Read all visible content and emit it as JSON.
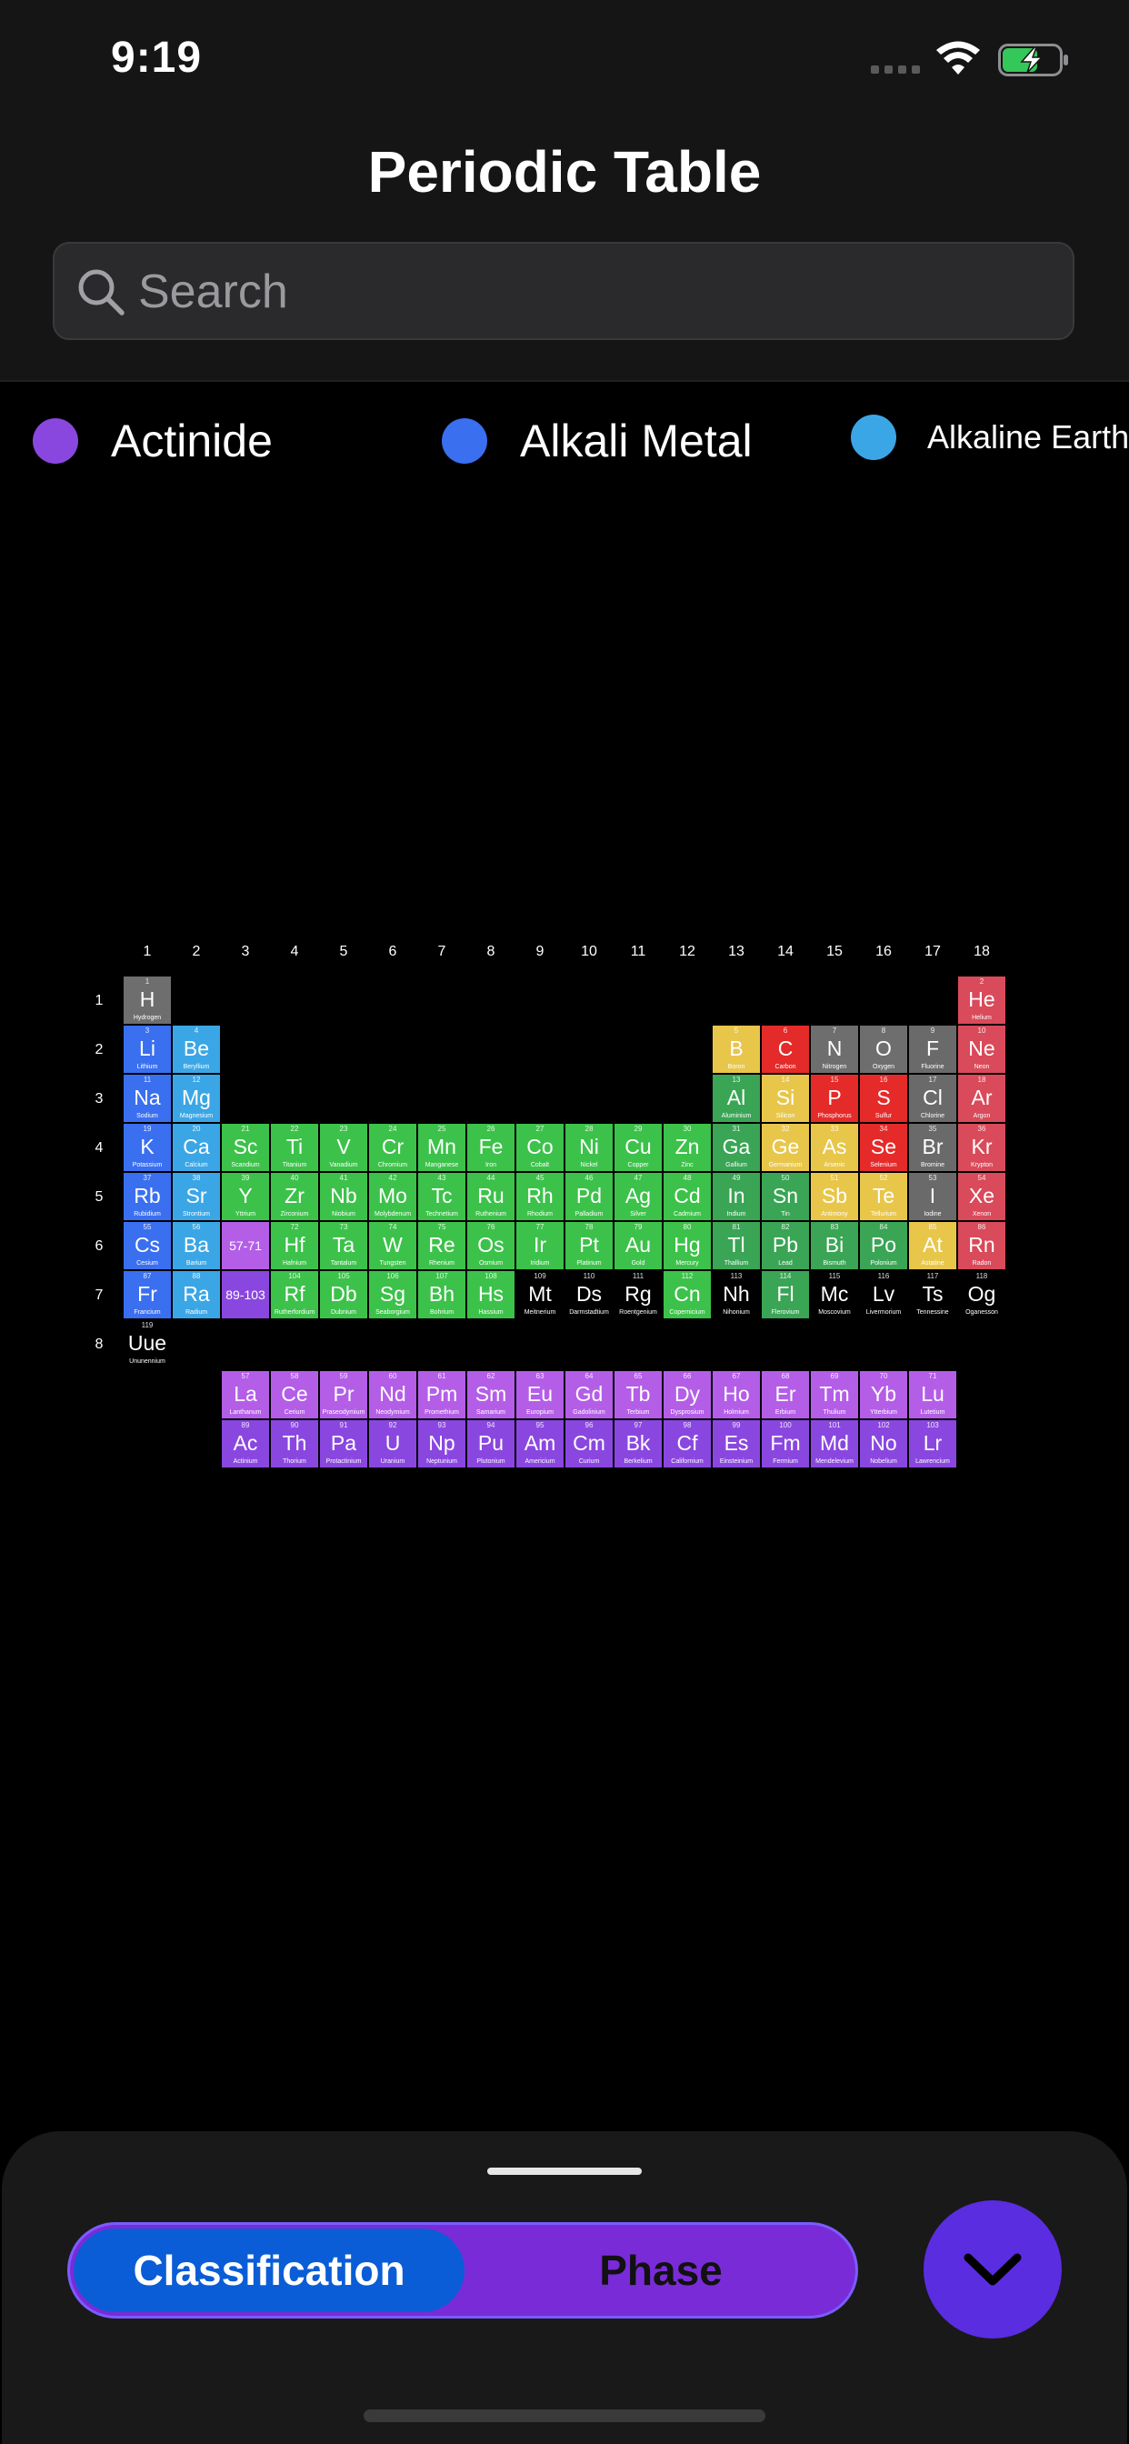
{
  "status": {
    "time": "9:19"
  },
  "header": {
    "title": "Periodic Table"
  },
  "search": {
    "placeholder": "Search"
  },
  "legend": [
    {
      "label": "Actinide",
      "color": "#8a47e0"
    },
    {
      "label": "Alkali Metal",
      "color": "#3a6ff0"
    },
    {
      "label": "Alkaline Earth",
      "color": "#3ba6e6"
    }
  ],
  "colors": {
    "H": "#6e6e6e",
    "noble": "#d94a5a",
    "alkali": "#3a6ff0",
    "alkaline": "#3ba6e6",
    "transition": "#3cc24a",
    "post": "#3aa555",
    "metalloid": "#e8c64a",
    "nonmetal": "#6e6e6e",
    "reactive": "#e52a2a",
    "halogen": "#6a6a6a",
    "lanth": "#b45ee8",
    "actin": "#8a47e0",
    "unknown": "#000000",
    "fab": "#5a2de0",
    "segActive": "#0a5dd6",
    "segBg": "#7a2bd8"
  },
  "groups": [
    "1",
    "2",
    "3",
    "4",
    "5",
    "6",
    "7",
    "8",
    "9",
    "10",
    "11",
    "12",
    "13",
    "14",
    "15",
    "16",
    "17",
    "18"
  ],
  "periods": [
    "1",
    "2",
    "3",
    "4",
    "5",
    "6",
    "7",
    "8"
  ],
  "placeholders": {
    "lanth": "57-71",
    "actin": "89-103"
  },
  "elements": [
    {
      "n": "1",
      "s": "H",
      "name": "Hydrogen",
      "g": 1,
      "p": 1,
      "c": "H"
    },
    {
      "n": "2",
      "s": "He",
      "name": "Helium",
      "g": 18,
      "p": 1,
      "c": "noble"
    },
    {
      "n": "3",
      "s": "Li",
      "name": "Lithium",
      "g": 1,
      "p": 2,
      "c": "alkali"
    },
    {
      "n": "4",
      "s": "Be",
      "name": "Beryllium",
      "g": 2,
      "p": 2,
      "c": "alkaline"
    },
    {
      "n": "5",
      "s": "B",
      "name": "Boron",
      "g": 13,
      "p": 2,
      "c": "metalloid"
    },
    {
      "n": "6",
      "s": "C",
      "name": "Carbon",
      "g": 14,
      "p": 2,
      "c": "reactive"
    },
    {
      "n": "7",
      "s": "N",
      "name": "Nitrogen",
      "g": 15,
      "p": 2,
      "c": "nonmetal"
    },
    {
      "n": "8",
      "s": "O",
      "name": "Oxygen",
      "g": 16,
      "p": 2,
      "c": "nonmetal"
    },
    {
      "n": "9",
      "s": "F",
      "name": "Fluorine",
      "g": 17,
      "p": 2,
      "c": "halogen"
    },
    {
      "n": "10",
      "s": "Ne",
      "name": "Neon",
      "g": 18,
      "p": 2,
      "c": "noble"
    },
    {
      "n": "11",
      "s": "Na",
      "name": "Sodium",
      "g": 1,
      "p": 3,
      "c": "alkali"
    },
    {
      "n": "12",
      "s": "Mg",
      "name": "Magnesium",
      "g": 2,
      "p": 3,
      "c": "alkaline"
    },
    {
      "n": "13",
      "s": "Al",
      "name": "Aluminium",
      "g": 13,
      "p": 3,
      "c": "post"
    },
    {
      "n": "14",
      "s": "Si",
      "name": "Silicon",
      "g": 14,
      "p": 3,
      "c": "metalloid"
    },
    {
      "n": "15",
      "s": "P",
      "name": "Phosphorus",
      "g": 15,
      "p": 3,
      "c": "reactive"
    },
    {
      "n": "16",
      "s": "S",
      "name": "Sulfur",
      "g": 16,
      "p": 3,
      "c": "reactive"
    },
    {
      "n": "17",
      "s": "Cl",
      "name": "Chlorine",
      "g": 17,
      "p": 3,
      "c": "halogen"
    },
    {
      "n": "18",
      "s": "Ar",
      "name": "Argon",
      "g": 18,
      "p": 3,
      "c": "noble"
    },
    {
      "n": "19",
      "s": "K",
      "name": "Potassium",
      "g": 1,
      "p": 4,
      "c": "alkali"
    },
    {
      "n": "20",
      "s": "Ca",
      "name": "Calcium",
      "g": 2,
      "p": 4,
      "c": "alkaline"
    },
    {
      "n": "21",
      "s": "Sc",
      "name": "Scandium",
      "g": 3,
      "p": 4,
      "c": "transition"
    },
    {
      "n": "22",
      "s": "Ti",
      "name": "Titanium",
      "g": 4,
      "p": 4,
      "c": "transition"
    },
    {
      "n": "23",
      "s": "V",
      "name": "Vanadium",
      "g": 5,
      "p": 4,
      "c": "transition"
    },
    {
      "n": "24",
      "s": "Cr",
      "name": "Chromium",
      "g": 6,
      "p": 4,
      "c": "transition"
    },
    {
      "n": "25",
      "s": "Mn",
      "name": "Manganese",
      "g": 7,
      "p": 4,
      "c": "transition"
    },
    {
      "n": "26",
      "s": "Fe",
      "name": "Iron",
      "g": 8,
      "p": 4,
      "c": "transition"
    },
    {
      "n": "27",
      "s": "Co",
      "name": "Cobalt",
      "g": 9,
      "p": 4,
      "c": "transition"
    },
    {
      "n": "28",
      "s": "Ni",
      "name": "Nickel",
      "g": 10,
      "p": 4,
      "c": "transition"
    },
    {
      "n": "29",
      "s": "Cu",
      "name": "Copper",
      "g": 11,
      "p": 4,
      "c": "transition"
    },
    {
      "n": "30",
      "s": "Zn",
      "name": "Zinc",
      "g": 12,
      "p": 4,
      "c": "transition"
    },
    {
      "n": "31",
      "s": "Ga",
      "name": "Gallium",
      "g": 13,
      "p": 4,
      "c": "post"
    },
    {
      "n": "32",
      "s": "Ge",
      "name": "Germanium",
      "g": 14,
      "p": 4,
      "c": "metalloid"
    },
    {
      "n": "33",
      "s": "As",
      "name": "Arsenic",
      "g": 15,
      "p": 4,
      "c": "metalloid"
    },
    {
      "n": "34",
      "s": "Se",
      "name": "Selenium",
      "g": 16,
      "p": 4,
      "c": "reactive"
    },
    {
      "n": "35",
      "s": "Br",
      "name": "Bromine",
      "g": 17,
      "p": 4,
      "c": "halogen"
    },
    {
      "n": "36",
      "s": "Kr",
      "name": "Krypton",
      "g": 18,
      "p": 4,
      "c": "noble"
    },
    {
      "n": "37",
      "s": "Rb",
      "name": "Rubidium",
      "g": 1,
      "p": 5,
      "c": "alkali"
    },
    {
      "n": "38",
      "s": "Sr",
      "name": "Strontium",
      "g": 2,
      "p": 5,
      "c": "alkaline"
    },
    {
      "n": "39",
      "s": "Y",
      "name": "Yttrium",
      "g": 3,
      "p": 5,
      "c": "transition"
    },
    {
      "n": "40",
      "s": "Zr",
      "name": "Zirconium",
      "g": 4,
      "p": 5,
      "c": "transition"
    },
    {
      "n": "41",
      "s": "Nb",
      "name": "Niobium",
      "g": 5,
      "p": 5,
      "c": "transition"
    },
    {
      "n": "42",
      "s": "Mo",
      "name": "Molybdenum",
      "g": 6,
      "p": 5,
      "c": "transition"
    },
    {
      "n": "43",
      "s": "Tc",
      "name": "Technetium",
      "g": 7,
      "p": 5,
      "c": "transition"
    },
    {
      "n": "44",
      "s": "Ru",
      "name": "Ruthenium",
      "g": 8,
      "p": 5,
      "c": "transition"
    },
    {
      "n": "45",
      "s": "Rh",
      "name": "Rhodium",
      "g": 9,
      "p": 5,
      "c": "transition"
    },
    {
      "n": "46",
      "s": "Pd",
      "name": "Palladium",
      "g": 10,
      "p": 5,
      "c": "transition"
    },
    {
      "n": "47",
      "s": "Ag",
      "name": "Silver",
      "g": 11,
      "p": 5,
      "c": "transition"
    },
    {
      "n": "48",
      "s": "Cd",
      "name": "Cadmium",
      "g": 12,
      "p": 5,
      "c": "transition"
    },
    {
      "n": "49",
      "s": "In",
      "name": "Indium",
      "g": 13,
      "p": 5,
      "c": "post"
    },
    {
      "n": "50",
      "s": "Sn",
      "name": "Tin",
      "g": 14,
      "p": 5,
      "c": "post"
    },
    {
      "n": "51",
      "s": "Sb",
      "name": "Antimony",
      "g": 15,
      "p": 5,
      "c": "metalloid"
    },
    {
      "n": "52",
      "s": "Te",
      "name": "Tellurium",
      "g": 16,
      "p": 5,
      "c": "metalloid"
    },
    {
      "n": "53",
      "s": "I",
      "name": "Iodine",
      "g": 17,
      "p": 5,
      "c": "halogen"
    },
    {
      "n": "54",
      "s": "Xe",
      "name": "Xenon",
      "g": 18,
      "p": 5,
      "c": "noble"
    },
    {
      "n": "55",
      "s": "Cs",
      "name": "Cesium",
      "g": 1,
      "p": 6,
      "c": "alkali"
    },
    {
      "n": "56",
      "s": "Ba",
      "name": "Barium",
      "g": 2,
      "p": 6,
      "c": "alkaline"
    },
    {
      "n": "72",
      "s": "Hf",
      "name": "Hafnium",
      "g": 4,
      "p": 6,
      "c": "transition"
    },
    {
      "n": "73",
      "s": "Ta",
      "name": "Tantalum",
      "g": 5,
      "p": 6,
      "c": "transition"
    },
    {
      "n": "74",
      "s": "W",
      "name": "Tungsten",
      "g": 6,
      "p": 6,
      "c": "transition"
    },
    {
      "n": "75",
      "s": "Re",
      "name": "Rhenium",
      "g": 7,
      "p": 6,
      "c": "transition"
    },
    {
      "n": "76",
      "s": "Os",
      "name": "Osmium",
      "g": 8,
      "p": 6,
      "c": "transition"
    },
    {
      "n": "77",
      "s": "Ir",
      "name": "Iridium",
      "g": 9,
      "p": 6,
      "c": "transition"
    },
    {
      "n": "78",
      "s": "Pt",
      "name": "Platinum",
      "g": 10,
      "p": 6,
      "c": "transition"
    },
    {
      "n": "79",
      "s": "Au",
      "name": "Gold",
      "g": 11,
      "p": 6,
      "c": "transition"
    },
    {
      "n": "80",
      "s": "Hg",
      "name": "Mercury",
      "g": 12,
      "p": 6,
      "c": "transition"
    },
    {
      "n": "81",
      "s": "Tl",
      "name": "Thallium",
      "g": 13,
      "p": 6,
      "c": "post"
    },
    {
      "n": "82",
      "s": "Pb",
      "name": "Lead",
      "g": 14,
      "p": 6,
      "c": "post"
    },
    {
      "n": "83",
      "s": "Bi",
      "name": "Bismuth",
      "g": 15,
      "p": 6,
      "c": "post"
    },
    {
      "n": "84",
      "s": "Po",
      "name": "Polonium",
      "g": 16,
      "p": 6,
      "c": "post"
    },
    {
      "n": "85",
      "s": "At",
      "name": "Astatine",
      "g": 17,
      "p": 6,
      "c": "metalloid"
    },
    {
      "n": "86",
      "s": "Rn",
      "name": "Radon",
      "g": 18,
      "p": 6,
      "c": "noble"
    },
    {
      "n": "87",
      "s": "Fr",
      "name": "Francium",
      "g": 1,
      "p": 7,
      "c": "alkali"
    },
    {
      "n": "88",
      "s": "Ra",
      "name": "Radium",
      "g": 2,
      "p": 7,
      "c": "alkaline"
    },
    {
      "n": "104",
      "s": "Rf",
      "name": "Rutherfordium",
      "g": 4,
      "p": 7,
      "c": "transition"
    },
    {
      "n": "105",
      "s": "Db",
      "name": "Dubnium",
      "g": 5,
      "p": 7,
      "c": "transition"
    },
    {
      "n": "106",
      "s": "Sg",
      "name": "Seaborgium",
      "g": 6,
      "p": 7,
      "c": "transition"
    },
    {
      "n": "107",
      "s": "Bh",
      "name": "Bohrium",
      "g": 7,
      "p": 7,
      "c": "transition"
    },
    {
      "n": "108",
      "s": "Hs",
      "name": "Hassium",
      "g": 8,
      "p": 7,
      "c": "transition"
    },
    {
      "n": "109",
      "s": "Mt",
      "name": "Meitnerium",
      "g": 9,
      "p": 7,
      "c": "unknown"
    },
    {
      "n": "110",
      "s": "Ds",
      "name": "Darmstadtium",
      "g": 10,
      "p": 7,
      "c": "unknown"
    },
    {
      "n": "111",
      "s": "Rg",
      "name": "Roentgenium",
      "g": 11,
      "p": 7,
      "c": "unknown"
    },
    {
      "n": "112",
      "s": "Cn",
      "name": "Copernicium",
      "g": 12,
      "p": 7,
      "c": "transition"
    },
    {
      "n": "113",
      "s": "Nh",
      "name": "Nihonium",
      "g": 13,
      "p": 7,
      "c": "unknown"
    },
    {
      "n": "114",
      "s": "Fl",
      "name": "Flerovium",
      "g": 14,
      "p": 7,
      "c": "post"
    },
    {
      "n": "115",
      "s": "Mc",
      "name": "Moscovium",
      "g": 15,
      "p": 7,
      "c": "unknown"
    },
    {
      "n": "116",
      "s": "Lv",
      "name": "Livermorium",
      "g": 16,
      "p": 7,
      "c": "unknown"
    },
    {
      "n": "117",
      "s": "Ts",
      "name": "Tennessine",
      "g": 17,
      "p": 7,
      "c": "unknown"
    },
    {
      "n": "118",
      "s": "Og",
      "name": "Oganesson",
      "g": 18,
      "p": 7,
      "c": "unknown"
    },
    {
      "n": "119",
      "s": "Uue",
      "name": "Ununennium",
      "g": 1,
      "p": 8,
      "c": "unknown"
    },
    {
      "n": "57",
      "s": "La",
      "name": "Lanthanum",
      "g": 3,
      "p": 9,
      "c": "lanth"
    },
    {
      "n": "58",
      "s": "Ce",
      "name": "Cerium",
      "g": 4,
      "p": 9,
      "c": "lanth"
    },
    {
      "n": "59",
      "s": "Pr",
      "name": "Praseodymium",
      "g": 5,
      "p": 9,
      "c": "lanth"
    },
    {
      "n": "60",
      "s": "Nd",
      "name": "Neodymium",
      "g": 6,
      "p": 9,
      "c": "lanth"
    },
    {
      "n": "61",
      "s": "Pm",
      "name": "Promethium",
      "g": 7,
      "p": 9,
      "c": "lanth"
    },
    {
      "n": "62",
      "s": "Sm",
      "name": "Samarium",
      "g": 8,
      "p": 9,
      "c": "lanth"
    },
    {
      "n": "63",
      "s": "Eu",
      "name": "Europium",
      "g": 9,
      "p": 9,
      "c": "lanth"
    },
    {
      "n": "64",
      "s": "Gd",
      "name": "Gadolinium",
      "g": 10,
      "p": 9,
      "c": "lanth"
    },
    {
      "n": "65",
      "s": "Tb",
      "name": "Terbium",
      "g": 11,
      "p": 9,
      "c": "lanth"
    },
    {
      "n": "66",
      "s": "Dy",
      "name": "Dysprosium",
      "g": 12,
      "p": 9,
      "c": "lanth"
    },
    {
      "n": "67",
      "s": "Ho",
      "name": "Holmium",
      "g": 13,
      "p": 9,
      "c": "lanth"
    },
    {
      "n": "68",
      "s": "Er",
      "name": "Erbium",
      "g": 14,
      "p": 9,
      "c": "lanth"
    },
    {
      "n": "69",
      "s": "Tm",
      "name": "Thulium",
      "g": 15,
      "p": 9,
      "c": "lanth"
    },
    {
      "n": "70",
      "s": "Yb",
      "name": "Ytterbium",
      "g": 16,
      "p": 9,
      "c": "lanth"
    },
    {
      "n": "71",
      "s": "Lu",
      "name": "Lutetium",
      "g": 17,
      "p": 9,
      "c": "lanth"
    },
    {
      "n": "89",
      "s": "Ac",
      "name": "Actinium",
      "g": 3,
      "p": 10,
      "c": "actin"
    },
    {
      "n": "90",
      "s": "Th",
      "name": "Thorium",
      "g": 4,
      "p": 10,
      "c": "actin"
    },
    {
      "n": "91",
      "s": "Pa",
      "name": "Protactinium",
      "g": 5,
      "p": 10,
      "c": "actin"
    },
    {
      "n": "92",
      "s": "U",
      "name": "Uranium",
      "g": 6,
      "p": 10,
      "c": "actin"
    },
    {
      "n": "93",
      "s": "Np",
      "name": "Neptunium",
      "g": 7,
      "p": 10,
      "c": "actin"
    },
    {
      "n": "94",
      "s": "Pu",
      "name": "Plutonium",
      "g": 8,
      "p": 10,
      "c": "actin"
    },
    {
      "n": "95",
      "s": "Am",
      "name": "Americium",
      "g": 9,
      "p": 10,
      "c": "actin"
    },
    {
      "n": "96",
      "s": "Cm",
      "name": "Curium",
      "g": 10,
      "p": 10,
      "c": "actin"
    },
    {
      "n": "97",
      "s": "Bk",
      "name": "Berkelium",
      "g": 11,
      "p": 10,
      "c": "actin"
    },
    {
      "n": "98",
      "s": "Cf",
      "name": "Californium",
      "g": 12,
      "p": 10,
      "c": "actin"
    },
    {
      "n": "99",
      "s": "Es",
      "name": "Einsteinium",
      "g": 13,
      "p": 10,
      "c": "actin"
    },
    {
      "n": "100",
      "s": "Fm",
      "name": "Fermium",
      "g": 14,
      "p": 10,
      "c": "actin"
    },
    {
      "n": "101",
      "s": "Md",
      "name": "Mendelevium",
      "g": 15,
      "p": 10,
      "c": "actin"
    },
    {
      "n": "102",
      "s": "No",
      "name": "Nobelium",
      "g": 16,
      "p": 10,
      "c": "actin"
    },
    {
      "n": "103",
      "s": "Lr",
      "name": "Lawrencium",
      "g": 17,
      "p": 10,
      "c": "actin"
    }
  ],
  "segments": {
    "classification": "Classification",
    "phase": "Phase"
  },
  "fab": {
    "icon": "chevron-down-icon"
  }
}
